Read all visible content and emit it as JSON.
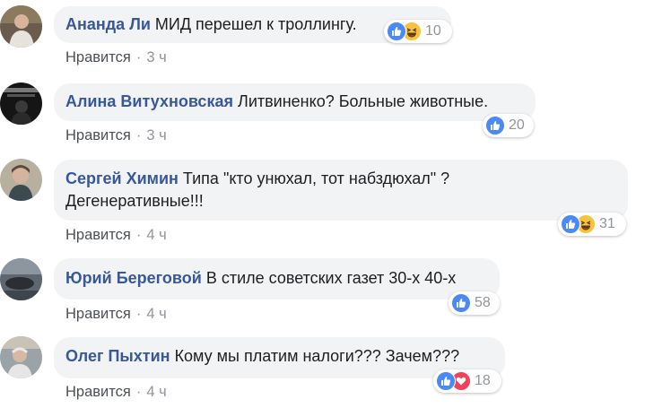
{
  "comments": [
    {
      "author": "Ананда Ли",
      "text": "МИД перешел к троллингу.",
      "like_label": "Нравится",
      "time": "3 ч",
      "reaction_count": "10",
      "reactions": [
        "like-icon",
        "haha-icon"
      ]
    },
    {
      "author": "Алина Витухновская",
      "text": "Литвиненко? Больные животные.",
      "like_label": "Нравится",
      "time": "3 ч",
      "reaction_count": "20",
      "reactions": [
        "like-icon"
      ]
    },
    {
      "author": "Сергей Химин",
      "text_line1": "Типа \"кто унюхал, тот набздюхал\" ?",
      "text_line2": "Дегенеративные!!!",
      "like_label": "Нравится",
      "time": "4 ч",
      "reaction_count": "31",
      "reactions": [
        "like-icon",
        "haha-icon"
      ]
    },
    {
      "author": "Юрий Береговой",
      "text": "В стиле советских газет 30-х 40-х",
      "like_label": "Нравится",
      "time": "4 ч",
      "reaction_count": "58",
      "reactions": [
        "like-icon"
      ]
    },
    {
      "author": "Олег Пыхтин",
      "text": "Кому мы платим налоги??? Зачем???",
      "like_label": "Нравится",
      "time": "4 ч",
      "reaction_count": "18",
      "reactions": [
        "like-icon",
        "love-icon"
      ]
    }
  ],
  "colors": {
    "author": "#385898",
    "bubble": "#f2f3f5",
    "like": "#4b89f5",
    "haha": "#f7c33b",
    "love": "#f0425a"
  }
}
